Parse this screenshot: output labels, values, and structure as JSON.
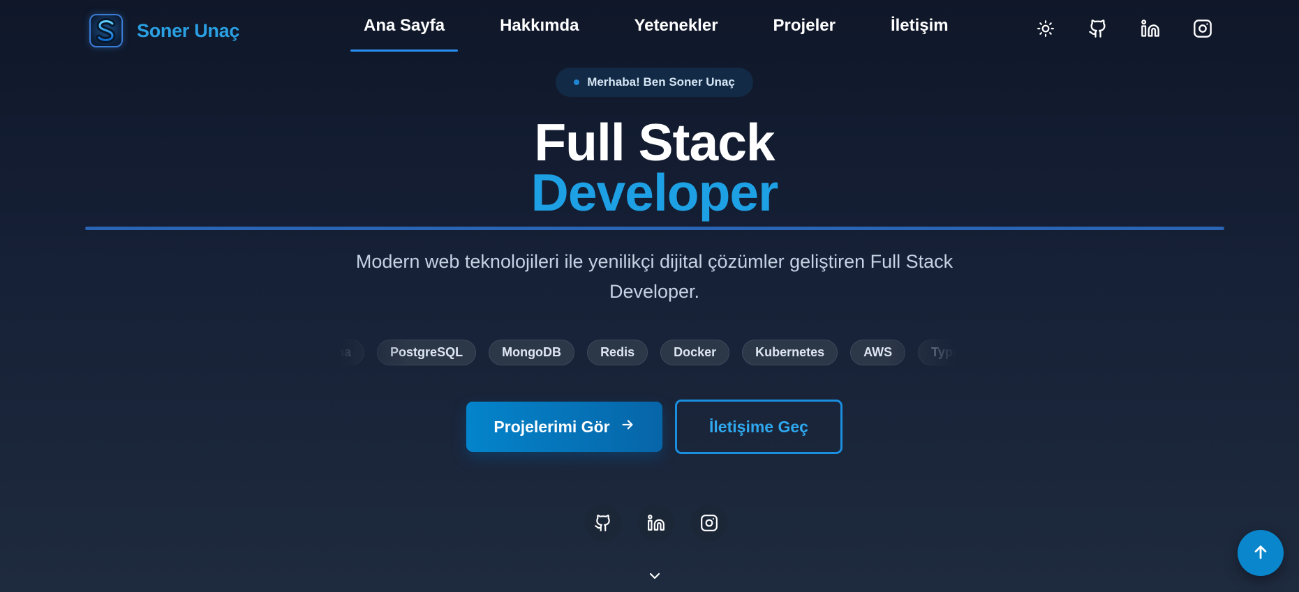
{
  "brand": {
    "name": "Soner Unaç",
    "logo_letter": "S",
    "logo_icon": "s-logo-icon"
  },
  "nav": {
    "links": [
      {
        "label": "Ana Sayfa",
        "active": true
      },
      {
        "label": "Hakkımda",
        "active": false
      },
      {
        "label": "Yetenekler",
        "active": false
      },
      {
        "label": "Projeler",
        "active": false
      },
      {
        "label": "İletişim",
        "active": false
      }
    ],
    "icons": [
      "sun-icon",
      "github-icon",
      "linkedin-icon",
      "instagram-icon"
    ]
  },
  "hero": {
    "badge": "Merhaba! Ben Soner Unaç",
    "title_line1": "Full Stack",
    "title_line2": "Developer",
    "subtitle_line1": "Modern web teknolojileri ile yenilikçi dijital çözümler geliştiren Full Stack",
    "subtitle_line2": "Developer."
  },
  "tech_chips": [
    "Prisma",
    "PostgreSQL",
    "MongoDB",
    "Redis",
    "Docker",
    "Kubernetes",
    "AWS",
    "TypeScript"
  ],
  "cta": {
    "primary_label": "Projelerimi Gör",
    "secondary_label": "İletişime Geç"
  },
  "social": [
    "github-icon",
    "linkedin-icon",
    "instagram-icon"
  ],
  "colors": {
    "background_top": "#0f1729",
    "background_bottom": "#1e2a3e",
    "accent": "#1ea0e4",
    "primary_button": "#0484cb",
    "outline_button_border": "#1b8ee0",
    "active_underline": "#2b8ff2"
  }
}
